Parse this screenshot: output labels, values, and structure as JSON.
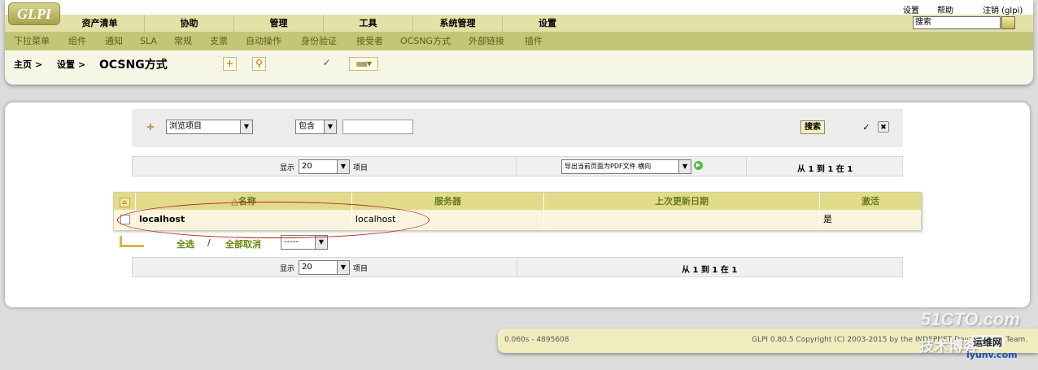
{
  "logo": {
    "text": "GLPI"
  },
  "topnav": {
    "settings": "设置",
    "help": "帮助",
    "logout": "注销 (glpi)"
  },
  "search": {
    "value": "搜索"
  },
  "main_menu": [
    "资产清单",
    "协助",
    "管理",
    "工具",
    "系统管理",
    "设置"
  ],
  "sub_menu": [
    "下拉菜单",
    "组件",
    "通知",
    "SLA",
    "常规",
    "支票",
    "自动操作",
    "身份验证",
    "接受者",
    "OCSNG方式",
    "外部链接",
    "插件"
  ],
  "breadcrumb": {
    "home": "主页 >",
    "settings": "设置 >",
    "current": "OCSNG方式"
  },
  "search_form": {
    "field_select": "浏览项目",
    "operator_select": "包含",
    "criteria_value": "",
    "submit_label": "搜索"
  },
  "pager": {
    "show_label": "显示",
    "per_page": "20",
    "items_label": "项目",
    "export_select": "导出当前页面为PDF文件 横向",
    "range": "从 1 到 1 在 1"
  },
  "table": {
    "columns": [
      "△名称",
      "服务器",
      "上次更新日期",
      "激活"
    ],
    "rows": [
      {
        "name": "localhost",
        "server": "localhost",
        "last_update": "",
        "active": "是"
      }
    ]
  },
  "massive": {
    "select_all": "全选",
    "separator": "/",
    "unselect_all": "全部取消",
    "action_select": "-----"
  },
  "footer": {
    "timing": "0.060s - 4895608",
    "copyright": "GLPI 0.80.5 Copyright (C) 2003-2015 by the INDEPNET Development Team."
  },
  "watermark": {
    "site": "51CTO.com",
    "blog": "技术博客",
    "tag": "运维网",
    "domain": "iyunv.com"
  },
  "colors": {
    "menu_bg": "#e4e1a7",
    "submenu_bg": "#c3c676",
    "table_header": "#e2dc8a",
    "row_bg": "#fbf3dc",
    "annotation": "#b82020"
  }
}
